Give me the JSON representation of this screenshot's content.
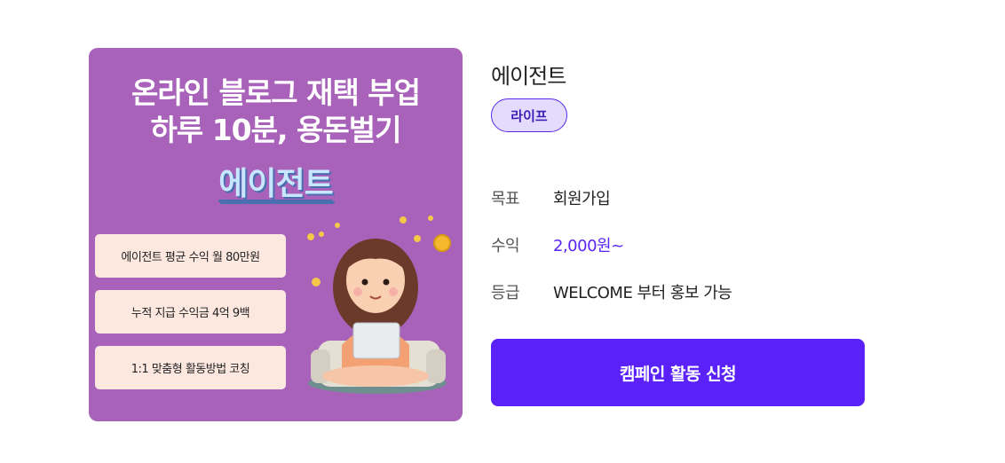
{
  "banner": {
    "headline_line1": "온라인 블로그 재택 부업",
    "headline_line2": "하루 10분, 용돈벌기",
    "brand": "에이전트",
    "benefits": [
      "에이전트 평균 수익 월 80만원",
      "누적 지급 수익금 4억 9백",
      "1:1 맞춤형 활동방법 코칭"
    ]
  },
  "campaign": {
    "title": "에이전트",
    "tag": "라이프",
    "details": [
      {
        "label": "목표",
        "value": "회원가입"
      },
      {
        "label": "수익",
        "value": "2,000원~"
      },
      {
        "label": "등급",
        "value": "WELCOME 부터 홍보 가능"
      }
    ],
    "cta_label": "캠페인 활동 신청"
  },
  "colors": {
    "banner_bg": "#a862b9",
    "accent": "#5a22f8",
    "tag_bg": "#e4dcfd"
  }
}
